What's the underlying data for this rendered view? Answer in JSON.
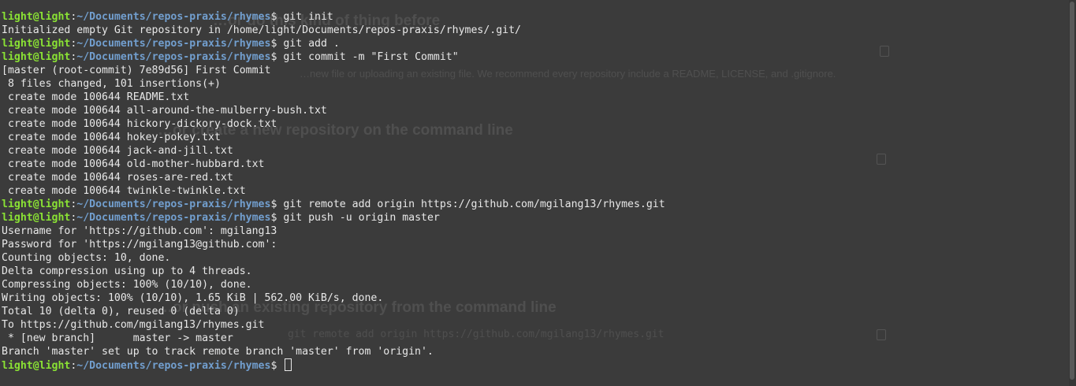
{
  "terminal": {
    "prompt": {
      "user_host": "light@light",
      "separator": ":",
      "cwd": "~/Documents/repos-praxis/rhymes",
      "symbol": "$"
    },
    "lines": [
      {
        "type": "cmd",
        "text": "git init"
      },
      {
        "type": "out",
        "text": "Initialized empty Git repository in /home/light/Documents/repos-praxis/rhymes/.git/"
      },
      {
        "type": "cmd",
        "text": "git add ."
      },
      {
        "type": "cmd",
        "text": "git commit -m \"First Commit\""
      },
      {
        "type": "out",
        "text": "[master (root-commit) 7e89d56] First Commit"
      },
      {
        "type": "out",
        "text": " 8 files changed, 101 insertions(+)"
      },
      {
        "type": "out",
        "text": " create mode 100644 README.txt"
      },
      {
        "type": "out",
        "text": " create mode 100644 all-around-the-mulberry-bush.txt"
      },
      {
        "type": "out",
        "text": " create mode 100644 hickory-dickory-dock.txt"
      },
      {
        "type": "out",
        "text": " create mode 100644 hokey-pokey.txt"
      },
      {
        "type": "out",
        "text": " create mode 100644 jack-and-jill.txt"
      },
      {
        "type": "out",
        "text": " create mode 100644 old-mother-hubbard.txt"
      },
      {
        "type": "out",
        "text": " create mode 100644 roses-are-red.txt"
      },
      {
        "type": "out",
        "text": " create mode 100644 twinkle-twinkle.txt"
      },
      {
        "type": "cmd",
        "text": "git remote add origin https://github.com/mgilang13/rhymes.git"
      },
      {
        "type": "cmd",
        "text": "git push -u origin master"
      },
      {
        "type": "out",
        "text": "Username for 'https://github.com': mgilang13"
      },
      {
        "type": "out",
        "text": "Password for 'https://mgilang13@github.com':"
      },
      {
        "type": "out",
        "text": "Counting objects: 10, done."
      },
      {
        "type": "out",
        "text": "Delta compression using up to 4 threads."
      },
      {
        "type": "out",
        "text": "Compressing objects: 100% (10/10), done."
      },
      {
        "type": "out",
        "text": "Writing objects: 100% (10/10), 1.65 KiB | 562.00 KiB/s, done."
      },
      {
        "type": "out",
        "text": "Total 10 (delta 0), reused 0 (delta 0)"
      },
      {
        "type": "out",
        "text": "To https://github.com/mgilang13/rhymes.git"
      },
      {
        "type": "out",
        "text": " * [new branch]      master -> master"
      },
      {
        "type": "out",
        "text": "Branch 'master' set up to track remote branch 'master' from 'origin'."
      },
      {
        "type": "cmd",
        "text": "",
        "cursor": true
      }
    ]
  },
  "background_page": {
    "headings": [
      "…or do this kind of thing before",
      "…or create a new repository on the command line",
      "…or push an existing repository from the command line"
    ],
    "hint": "…new file or uploading an existing file. We recommend every repository include a README, LICENSE, and .gitignore.",
    "code_lines": [
      "git remote add origin https://github.com/mgilang13/rhymes.git"
    ]
  },
  "colors": {
    "background": "#3b3b3b",
    "text": "#e8e8e8",
    "prompt_user": "#8ae234",
    "prompt_path": "#729fcf"
  }
}
